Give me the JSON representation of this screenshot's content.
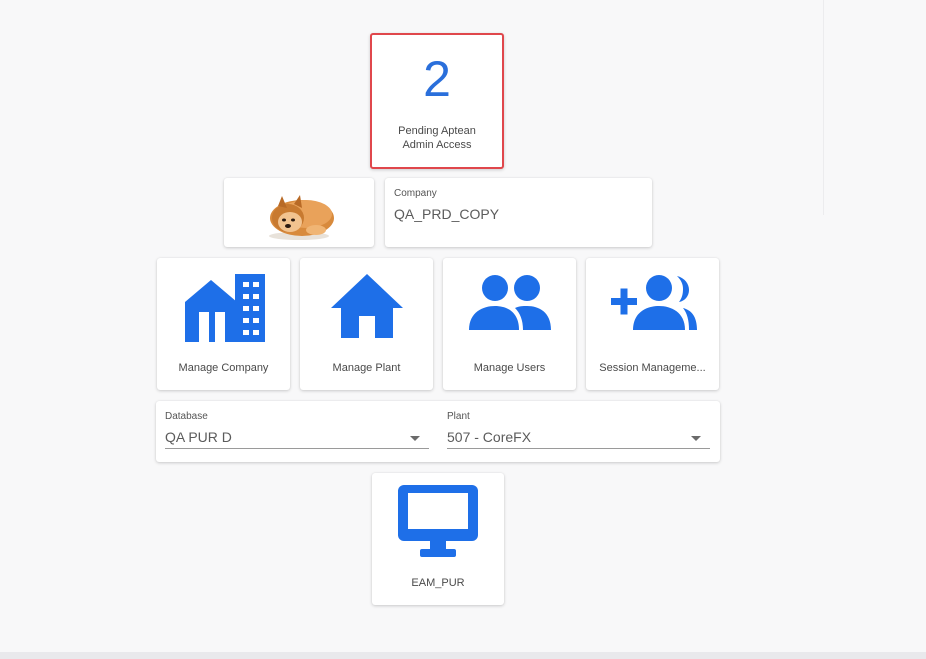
{
  "pending": {
    "count": "2",
    "label": "Pending Aptean Admin Access"
  },
  "company": {
    "caption": "Company",
    "value": "QA_PRD_COPY"
  },
  "tiles": [
    {
      "label": "Manage Company",
      "icon": "building-icon"
    },
    {
      "label": "Manage Plant",
      "icon": "home-icon"
    },
    {
      "label": "Manage Users",
      "icon": "users-icon"
    },
    {
      "label": "Session Manageme...",
      "icon": "add-users-icon"
    }
  ],
  "database": {
    "caption": "Database",
    "value": "QA PUR D"
  },
  "plant": {
    "caption": "Plant",
    "value": "507 - CoreFX"
  },
  "app": {
    "label": "EAM_PUR",
    "icon": "monitor-icon"
  },
  "colors": {
    "accent": "#1e6fe8",
    "highlight_border": "#e0474c",
    "count": "#2a6fdb"
  }
}
